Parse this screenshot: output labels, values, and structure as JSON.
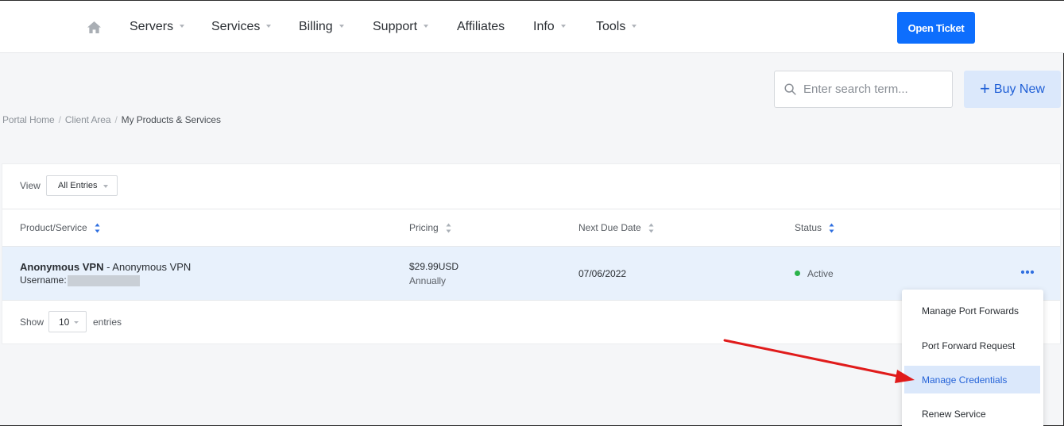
{
  "nav": {
    "items": [
      {
        "label": "Servers",
        "dropdown": true
      },
      {
        "label": "Services",
        "dropdown": true
      },
      {
        "label": "Billing",
        "dropdown": true
      },
      {
        "label": "Support",
        "dropdown": true
      },
      {
        "label": "Affiliates",
        "dropdown": false
      },
      {
        "label": "Info",
        "dropdown": true
      },
      {
        "label": "Tools",
        "dropdown": true
      }
    ],
    "open_ticket_label": "Open Ticket"
  },
  "search": {
    "placeholder": "Enter search term..."
  },
  "buy_new": {
    "plus": "+",
    "label": "Buy New"
  },
  "breadcrumb": {
    "items": [
      "Portal Home",
      "Client Area",
      "My Products & Services"
    ],
    "separator": "/"
  },
  "table": {
    "view_label": "View",
    "view_selected": "All Entries",
    "columns": [
      "Product/Service",
      "Pricing",
      "Next Due Date",
      "Status"
    ],
    "rows": [
      {
        "product_name": "Anonymous VPN",
        "product_group": " - Anonymous VPN",
        "username_label": "Username:",
        "price": "$29.99USD",
        "cycle": "Annually",
        "next_due": "07/06/2022",
        "status": "Active"
      }
    ],
    "show_label": "Show",
    "page_length": "10",
    "entries_label": "entries"
  },
  "menu": {
    "items": [
      {
        "label": "Manage Port Forwards",
        "active": false
      },
      {
        "label": "Port Forward Request",
        "active": false
      },
      {
        "label": "Manage Credentials",
        "active": true
      },
      {
        "label": "Renew Service",
        "active": false
      }
    ]
  },
  "colors": {
    "primary": "#0d6efd",
    "row_highlight": "#e8f1fc",
    "status_active": "#2bb34a",
    "annotation_arrow": "#e01b1b"
  }
}
